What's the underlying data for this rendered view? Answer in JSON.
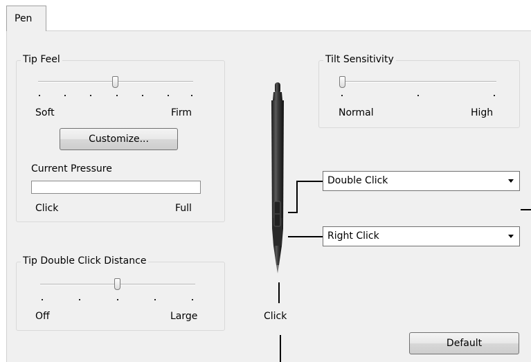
{
  "tab": {
    "label": "Pen"
  },
  "tip_feel": {
    "title": "Tip Feel",
    "min_label": "Soft",
    "max_label": "Firm",
    "level": 0.5,
    "customize_label": "Customize...",
    "pressure_title": "Current Pressure",
    "pressure_value": 0,
    "pressure_min_label": "Click",
    "pressure_max_label": "Full"
  },
  "tip_double_click": {
    "title": "Tip Double Click Distance",
    "min_label": "Off",
    "max_label": "Large",
    "level": 0.5
  },
  "tilt": {
    "title": "Tilt Sensitivity",
    "min_label": "Normal",
    "max_label": "High",
    "level": 0
  },
  "pen_buttons": {
    "upper": {
      "selected": "Double Click"
    },
    "lower": {
      "selected": "Right Click"
    },
    "tip_label": "Click"
  },
  "default_button": {
    "label": "Default"
  }
}
